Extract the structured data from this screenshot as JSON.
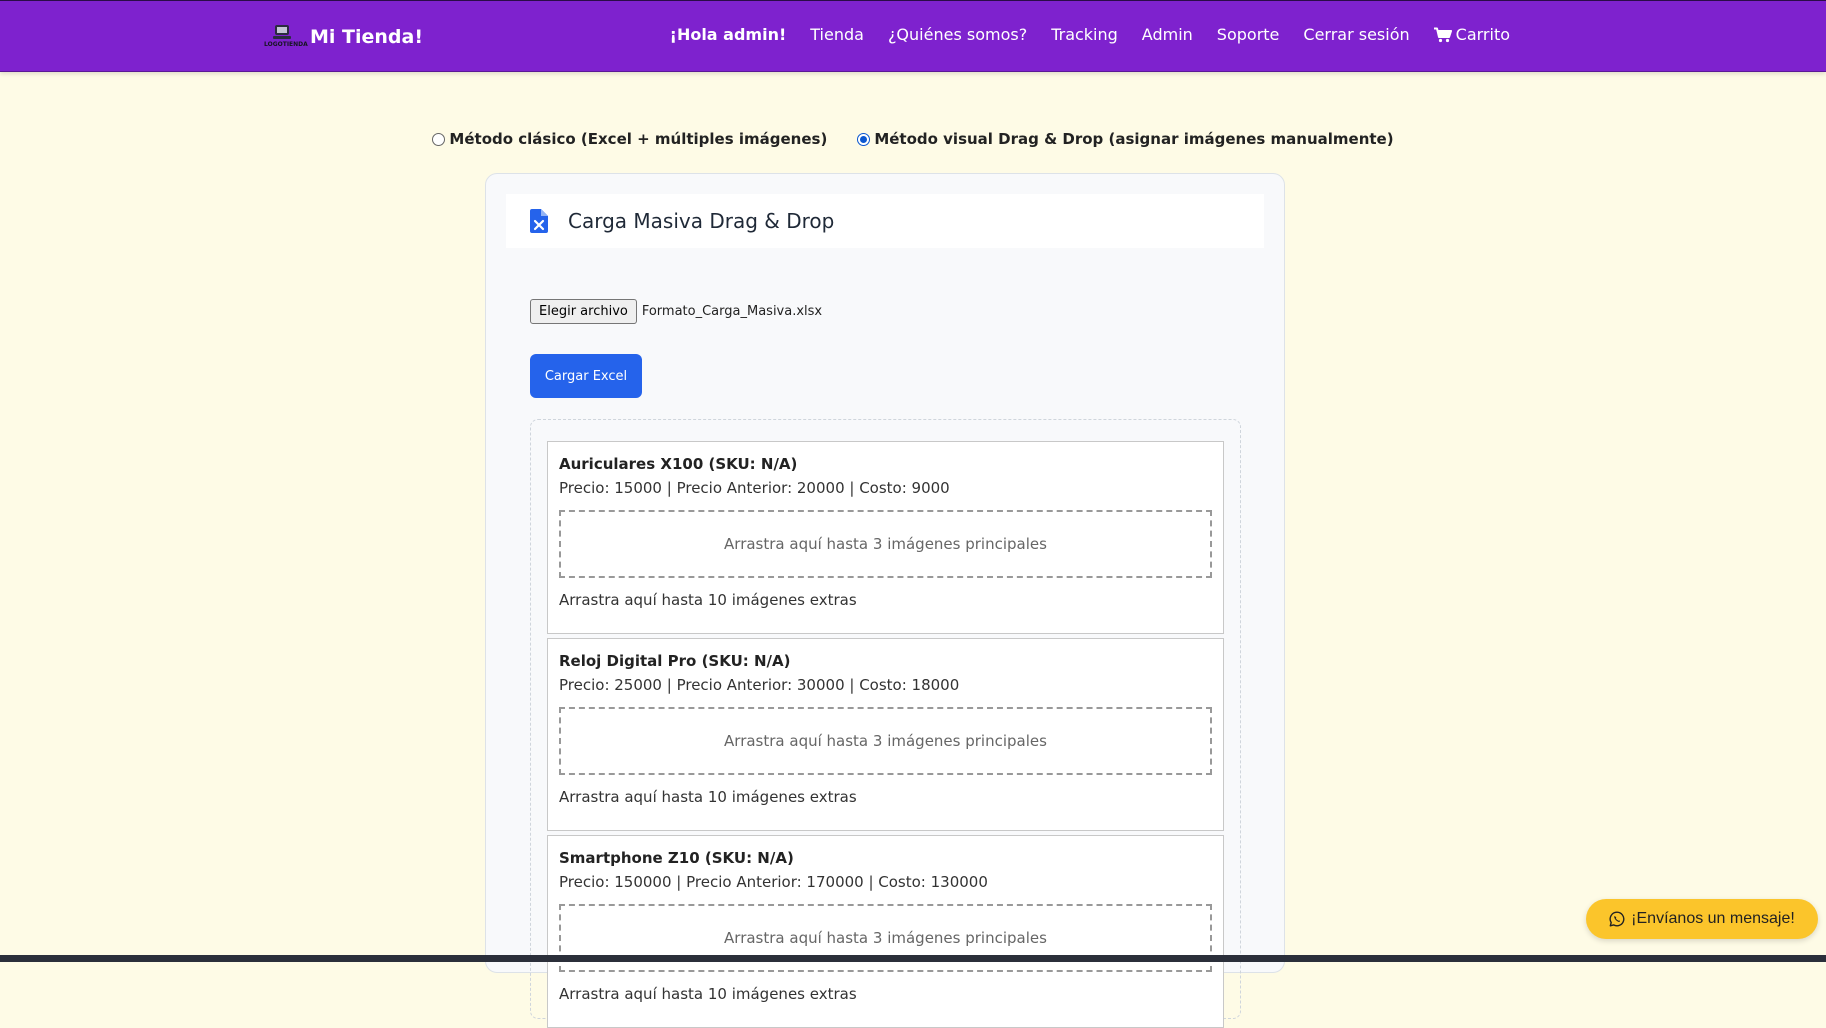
{
  "nav": {
    "brand_logo_text": "LOGOTIENDA",
    "brand_name": "Mi Tienda!",
    "greeting": "¡Hola admin!",
    "links": [
      "Tienda",
      "¿Quiénes somos?",
      "Tracking",
      "Admin",
      "Soporte",
      "Cerrar sesión"
    ],
    "cart": "Carrito"
  },
  "methods": [
    {
      "label": "Método clásico (Excel + múltiples imágenes)",
      "checked": false
    },
    {
      "label": "Método visual Drag & Drop (asignar imágenes manualmente)",
      "checked": true
    }
  ],
  "card": {
    "title": "Carga Masiva Drag & Drop",
    "file_button": "Elegir archivo",
    "file_name": "Formato_Carga_Masiva.xlsx",
    "load_button": "Cargar Excel"
  },
  "products": [
    {
      "name": "Auriculares X100 (SKU: N/A)",
      "meta": "Precio: 15000 | Precio Anterior: 20000 | Costo: 9000",
      "dropzone": "Arrastra aquí hasta 3 imágenes principales",
      "extras": "Arrastra aquí hasta 10 imágenes extras"
    },
    {
      "name": "Reloj Digital Pro (SKU: N/A)",
      "meta": "Precio: 25000 | Precio Anterior: 30000 | Costo: 18000",
      "dropzone": "Arrastra aquí hasta 3 imágenes principales",
      "extras": "Arrastra aquí hasta 10 imágenes extras"
    },
    {
      "name": "Smartphone Z10 (SKU: N/A)",
      "meta": "Precio: 150000 | Precio Anterior: 170000 | Costo: 130000",
      "dropzone": "Arrastra aquí hasta 3 imágenes principales",
      "extras": "Arrastra aquí hasta 10 imágenes extras"
    }
  ],
  "whatsapp_button": "¡Envíanos un mensaje!",
  "colors": {
    "navbar": "#7e22ce",
    "page_background": "#fefbe6",
    "primary_button": "#2563eb",
    "whatsapp_button": "#fbc52b"
  },
  "icons": {
    "brand": "laptop-logo-icon",
    "cart": "cart-icon",
    "card_header": "excel-file-icon",
    "whatsapp": "whatsapp-icon"
  }
}
